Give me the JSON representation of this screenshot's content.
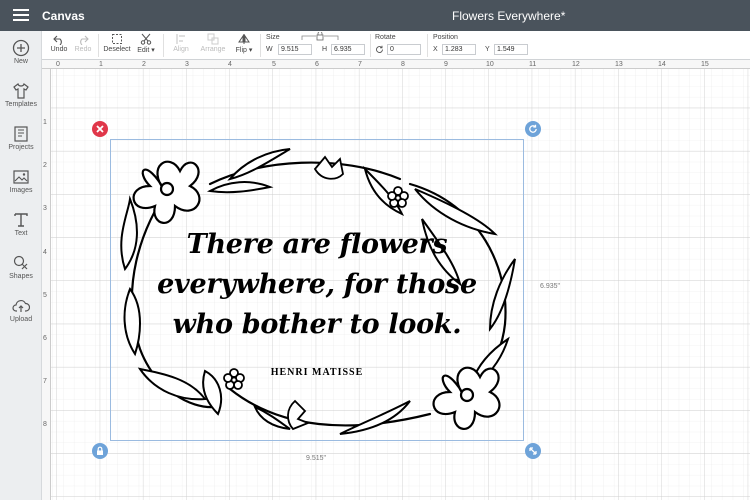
{
  "topbar": {
    "app_title": "Canvas",
    "document_title": "Flowers Everywhere*"
  },
  "leftrail": {
    "items": [
      {
        "label": "New",
        "icon": "plus-circle-icon"
      },
      {
        "label": "Templates",
        "icon": "tshirt-icon"
      },
      {
        "label": "Projects",
        "icon": "projects-icon"
      },
      {
        "label": "Images",
        "icon": "image-icon"
      },
      {
        "label": "Text",
        "icon": "text-icon"
      },
      {
        "label": "Shapes",
        "icon": "shapes-icon"
      },
      {
        "label": "Upload",
        "icon": "cloud-upload-icon"
      }
    ]
  },
  "toolbar": {
    "undo": "Undo",
    "redo": "Redo",
    "deselect": "Deselect",
    "edit": "Edit",
    "align": "Align",
    "arrange": "Arrange",
    "flip": "Flip",
    "size_label": "Size",
    "w_label": "W",
    "w_value": "9.515",
    "h_label": "H",
    "h_value": "6.935",
    "rotate_label": "Rotate",
    "rotate_value": "0",
    "position_label": "Position",
    "x_label": "X",
    "x_value": "1.283",
    "y_label": "Y",
    "y_value": "1.549"
  },
  "canvas": {
    "ruler_top": [
      "0",
      "1",
      "2",
      "3",
      "4",
      "5",
      "6",
      "7",
      "8",
      "9",
      "10",
      "11",
      "12",
      "13",
      "14",
      "15"
    ],
    "ruler_left": [
      "1",
      "2",
      "3",
      "4",
      "5",
      "6",
      "7",
      "8"
    ],
    "width_readout": "9.515\"",
    "height_readout": "6.935\"",
    "quote_lines": [
      "There are flowers",
      "everywhere, for those",
      "who bother to look."
    ],
    "author": "HENRI MATISSE"
  },
  "colors": {
    "topbar": "#4a535c",
    "delete_handle": "#e0374a",
    "handle": "#6ea3d9",
    "selection": "#9bbbe0"
  }
}
